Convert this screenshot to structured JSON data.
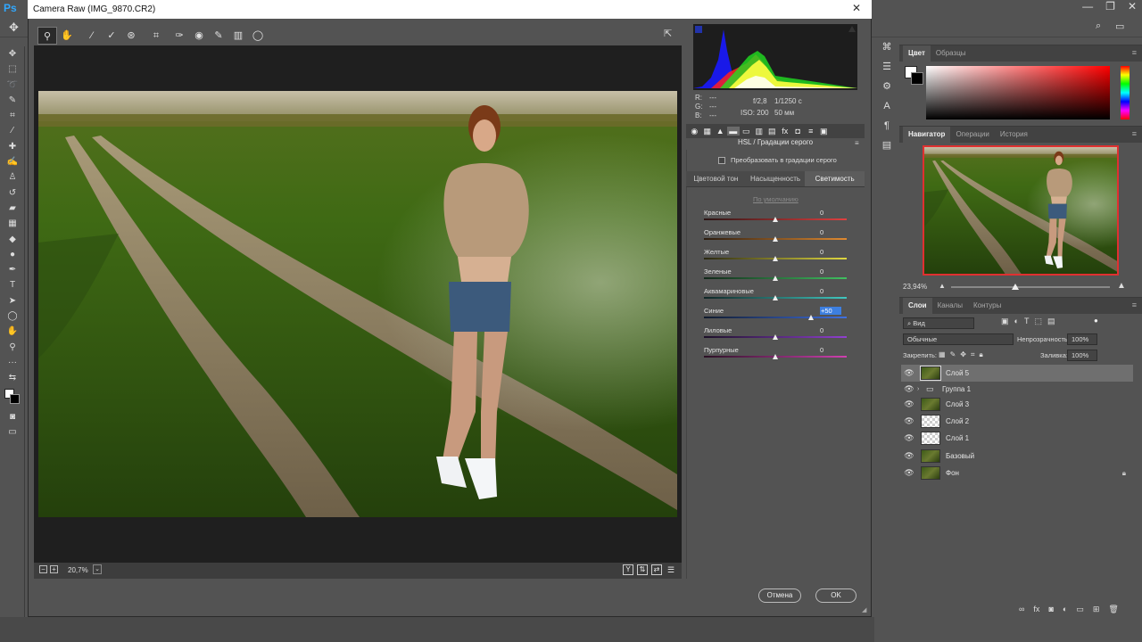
{
  "app": {
    "logo": "Ps"
  },
  "camera_raw": {
    "title": "Camera Raw (IMG_9870.CR2)",
    "tools": [
      "zoom-icon",
      "hand-icon",
      "white-balance-icon",
      "color-sampler-icon",
      "target-adjust-icon",
      "crop-icon",
      "straighten-icon",
      "spot-removal-icon",
      "red-eye-icon",
      "adjustment-brush-icon",
      "graduated-filter-icon",
      "radial-filter-icon"
    ],
    "zoom_level": "20,7%",
    "info": {
      "r_label": "R:",
      "r_val": "---",
      "g_label": "G:",
      "g_val": "---",
      "b_label": "B:",
      "b_val": "---",
      "aperture": "f/2,8",
      "shutter": "1/1250 с",
      "iso": "ISO: 200",
      "focal": "50 мм"
    },
    "panel_title": "HSL / Градации серого",
    "convert_gray_label": "Преобразовать в градации серого",
    "subtabs": [
      {
        "label": "Цветовой тон",
        "active": false
      },
      {
        "label": "Насыщенность",
        "active": false
      },
      {
        "label": "Светимость",
        "active": true
      }
    ],
    "default_link": "По умолчанию",
    "sliders": [
      {
        "label": "Красные",
        "value": "0",
        "pos": 0.5,
        "gradient": "linear-gradient(to right,#2a1414,#e04040)"
      },
      {
        "label": "Оранжевые",
        "value": "0",
        "pos": 0.5,
        "gradient": "linear-gradient(to right,#2b1c10,#e08a30)"
      },
      {
        "label": "Желтые",
        "value": "0",
        "pos": 0.5,
        "gradient": "linear-gradient(to right,#2a2812,#e0d840)"
      },
      {
        "label": "Зеленые",
        "value": "0",
        "pos": 0.5,
        "gradient": "linear-gradient(to right,#12281a,#40c060)"
      },
      {
        "label": "Аквамариновые",
        "value": "0",
        "pos": 0.5,
        "gradient": "linear-gradient(to right,#102626,#40c8c0)"
      },
      {
        "label": "Синие",
        "value": "+50",
        "pos": 0.75,
        "gradient": "linear-gradient(to right,#101a2c,#4070e0)",
        "highlight": true
      },
      {
        "label": "Лиловые",
        "value": "0",
        "pos": 0.5,
        "gradient": "linear-gradient(to right,#1c1028,#9040d0)"
      },
      {
        "label": "Пурпурные",
        "value": "0",
        "pos": 0.5,
        "gradient": "linear-gradient(to right,#2a1024,#d040b0)"
      }
    ],
    "cancel_label": "Отмена",
    "ok_label": "OK"
  },
  "color_panel": {
    "tabs": [
      "Цвет",
      "Образцы"
    ]
  },
  "navigator": {
    "tabs": [
      "Навигатор",
      "Операции",
      "История"
    ],
    "zoom": "23,94%"
  },
  "layers": {
    "tabs": [
      "Слои",
      "Каналы",
      "Контуры"
    ],
    "filter_label": "Вид",
    "blend_mode": "Обычные",
    "opacity_label": "Непрозрачность:",
    "opacity_value": "100%",
    "lock_label": "Закрепить:",
    "fill_label": "Заливка:",
    "fill_value": "100%",
    "items": [
      {
        "name": "Слой 5",
        "thumb": "photo",
        "selected": true
      },
      {
        "name": "Группа 1",
        "thumb": "folder",
        "selected": false
      },
      {
        "name": "Слой 3",
        "thumb": "photo",
        "selected": false
      },
      {
        "name": "Слой 2",
        "thumb": "trans",
        "selected": false
      },
      {
        "name": "Слой 1",
        "thumb": "trans",
        "selected": false
      },
      {
        "name": "Базовый",
        "thumb": "photo",
        "selected": false
      },
      {
        "name": "Фон",
        "thumb": "photo",
        "selected": false,
        "locked": true
      }
    ]
  }
}
